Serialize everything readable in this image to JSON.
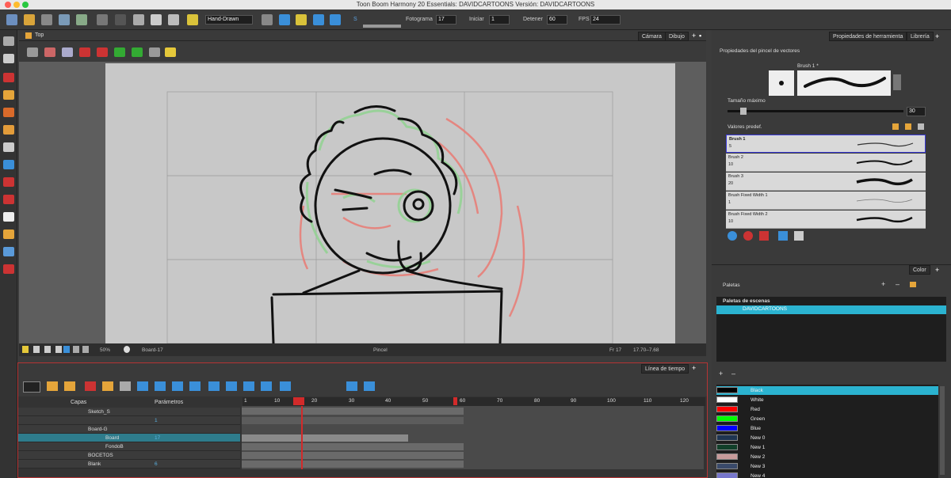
{
  "window": {
    "title": "Toon Boom Harmony 20 Essentials: DAVIDCARTOONS Versión: DAVIDCARTOONS"
  },
  "toolbar": {
    "workspace": "Hand-Drawn",
    "frame_label": "Fotograma",
    "frame_value": "17",
    "start_label": "Iniciar",
    "start_value": "1",
    "stop_label": "Detener",
    "stop_value": "60",
    "fps_label": "FPS",
    "fps_value": "24",
    "sound_label": "S"
  },
  "view": {
    "breadcrumb": "Top",
    "tab_camera": "Cámara",
    "tab_drawing": "Dibujo",
    "status": {
      "zoom": "50%",
      "layer": "Board-17",
      "tool": "Pincel",
      "frame": "Fr 17",
      "coords": "17.70–7.68"
    }
  },
  "timeline": {
    "tab": "Línea de tiempo",
    "layers_header": "Capas",
    "params_header": "Parámetros",
    "ruler": [
      "10",
      "20",
      "30",
      "40",
      "50",
      "60",
      "70",
      "80",
      "90",
      "100",
      "110",
      "120"
    ],
    "ruler_first": "1",
    "layers": [
      {
        "name": "Sketch_S",
        "param": ""
      },
      {
        "name": "",
        "param": "1"
      },
      {
        "name": "Board-G",
        "param": ""
      },
      {
        "name": "Board",
        "param": "17"
      },
      {
        "name": "FondoB",
        "param": ""
      },
      {
        "name": "BOCETOS",
        "param": ""
      },
      {
        "name": "Blank",
        "param": "6"
      }
    ]
  },
  "tool_properties": {
    "tab": "Propiedades de herramienta",
    "tab_library": "Librería",
    "section_title": "Propiedades del pincel de vectores",
    "brush_name": "Brush 1 *",
    "max_size_label": "Tamaño máximo",
    "max_size_value": "30",
    "presets_label": "Valores predef.",
    "presets": [
      {
        "name": "Brush 1",
        "size": "5"
      },
      {
        "name": "Brush 2",
        "size": "10"
      },
      {
        "name": "Brush 3",
        "size": "20"
      },
      {
        "name": "Brush Fixed Width 1",
        "size": "1"
      },
      {
        "name": "Brush Fixed Width 2",
        "size": "10"
      }
    ]
  },
  "color_panel": {
    "tab": "Color",
    "palettes_label": "Paletas",
    "scene_palettes_label": "Paletas de escenas",
    "palette_name": "DAVIDCARTOONS",
    "colors": [
      {
        "name": "Black",
        "hex": "#000000"
      },
      {
        "name": "White",
        "hex": "#ffffff"
      },
      {
        "name": "Red",
        "hex": "#ff0000"
      },
      {
        "name": "Green",
        "hex": "#00ff00"
      },
      {
        "name": "Blue",
        "hex": "#0000ff"
      },
      {
        "name": "New 0",
        "hex": "#1f3552"
      },
      {
        "name": "New 1",
        "hex": "#12402a"
      },
      {
        "name": "New 2",
        "hex": "#c79a9a"
      },
      {
        "name": "New 3",
        "hex": "#3a4a6a"
      },
      {
        "name": "New 4",
        "hex": "#7777cc"
      }
    ]
  },
  "colors": {
    "accent": "#2bb3d0",
    "selected_row": "#2e7c8c",
    "playhead": "#d22a2a",
    "timeline_border": "#b53434"
  }
}
